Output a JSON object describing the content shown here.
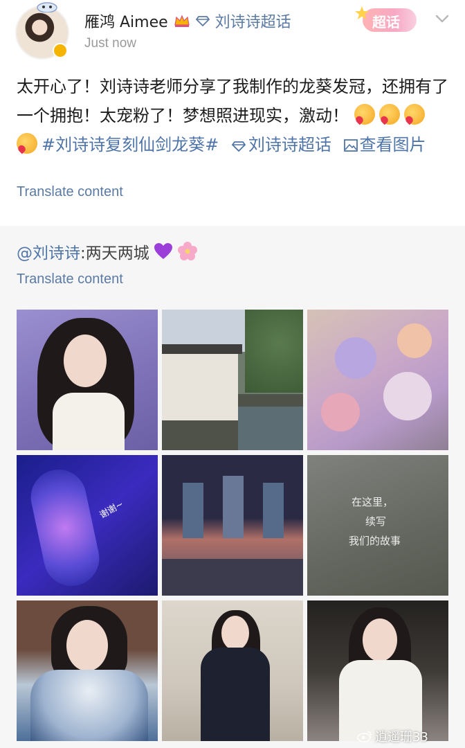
{
  "post": {
    "author": {
      "name": "雁鸿 Aimee",
      "timestamp": "Just now",
      "topic_link": "刘诗诗超话"
    },
    "badge": {
      "label": "超话"
    },
    "body": {
      "line_text": "太开心了！刘诗诗老师分享了我制作的龙葵发冠，还拥有了一个拥抱！太宠粉了！梦想照进现实，激动！",
      "hashtag": "#刘诗诗复刻仙剑龙葵#",
      "super_topic": "刘诗诗超话",
      "view_images": "查看图片"
    },
    "translate_label": "Translate content"
  },
  "repost": {
    "mention": "@刘诗诗",
    "text": ":两天两城",
    "translate_label": "Translate content",
    "photos": [
      {
        "name": "photo-portrait-white-blouse"
      },
      {
        "name": "photo-canal-town"
      },
      {
        "name": "photo-flower-bouquet"
      },
      {
        "name": "photo-floral-headpiece"
      },
      {
        "name": "photo-stage-night"
      },
      {
        "name": "photo-message-wall"
      },
      {
        "name": "photo-portrait-blue-dress"
      },
      {
        "name": "photo-portrait-black-blazer"
      },
      {
        "name": "photo-portrait-lace-dress"
      }
    ],
    "photo_captions": {
      "thanks": "谢谢~",
      "wall_line1": "在这里，",
      "wall_line2": "续写",
      "wall_line3": "我们的故事"
    }
  },
  "watermark": {
    "text": "逍遥珊33"
  },
  "colors": {
    "link": "#4e74a8",
    "muted": "#9a9a9a",
    "repost_bg": "#f6f6f6"
  },
  "icons": [
    "crown-icon",
    "diamond-icon",
    "star-icon",
    "chevron-down-icon",
    "image-icon",
    "purple-heart-icon",
    "cherry-blossom-icon",
    "weibo-icon"
  ]
}
